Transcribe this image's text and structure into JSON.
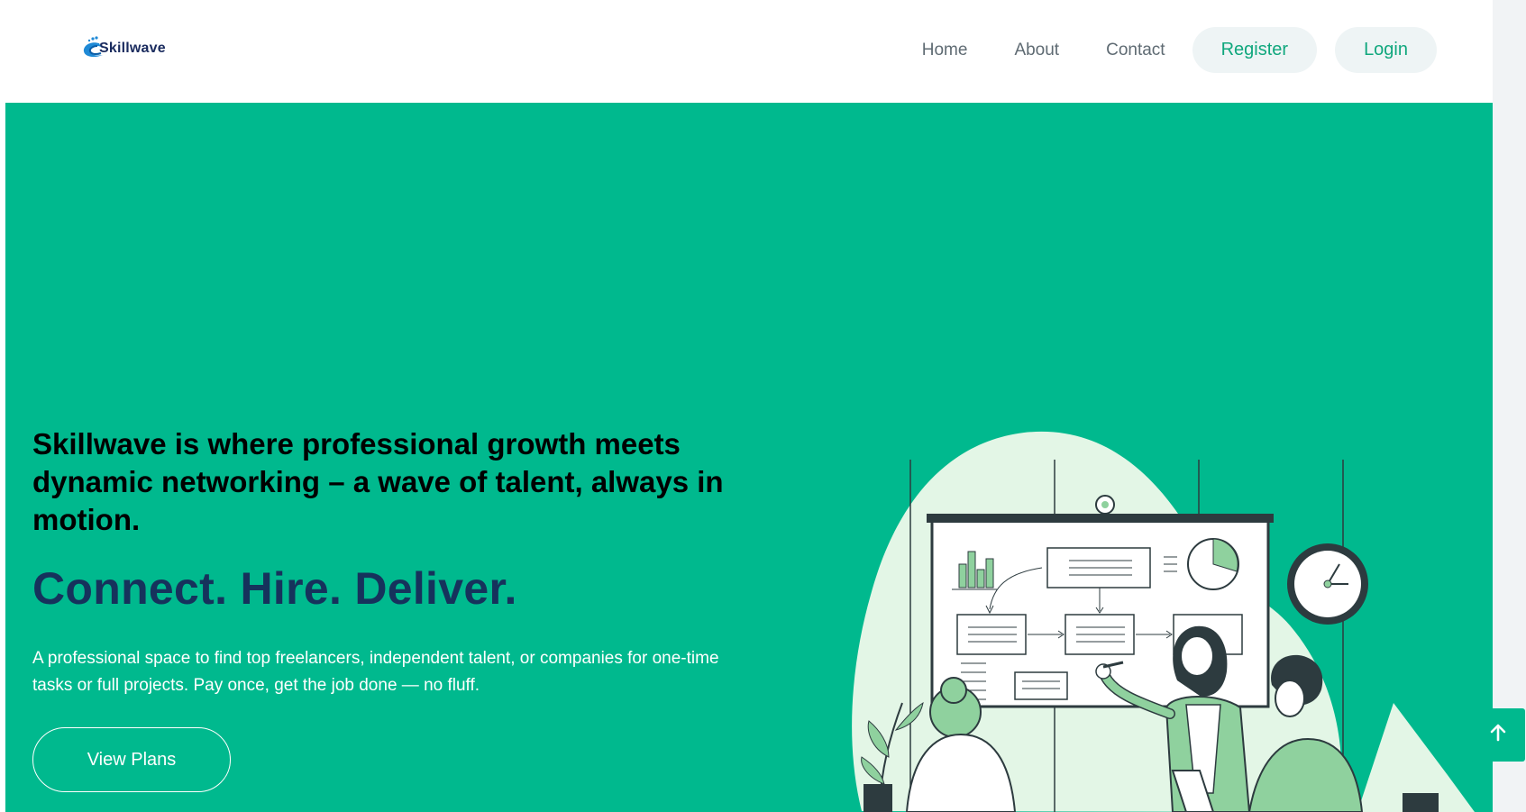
{
  "header": {
    "logo_text": "Skillwave",
    "nav": {
      "home": "Home",
      "about": "About",
      "contact": "Contact",
      "register": "Register",
      "login": "Login"
    }
  },
  "hero": {
    "heading": "Skillwave is where professional growth meets dynamic networking – a wave of talent, always in motion.",
    "tagline": "Connect. Hire. Deliver.",
    "description": "A professional space to find top freelancers, independent talent, or companies for one-time tasks or full projects. Pay once, get the job done — no fluff.",
    "cta_label": "View Plans"
  },
  "colors": {
    "brand_green": "#00b98e",
    "navy": "#16325c",
    "pill_bg": "#eef4f5",
    "pill_text": "#10a77d"
  },
  "icons": {
    "scroll_top": "arrow-up-icon",
    "logo": "wave-logo-icon"
  }
}
